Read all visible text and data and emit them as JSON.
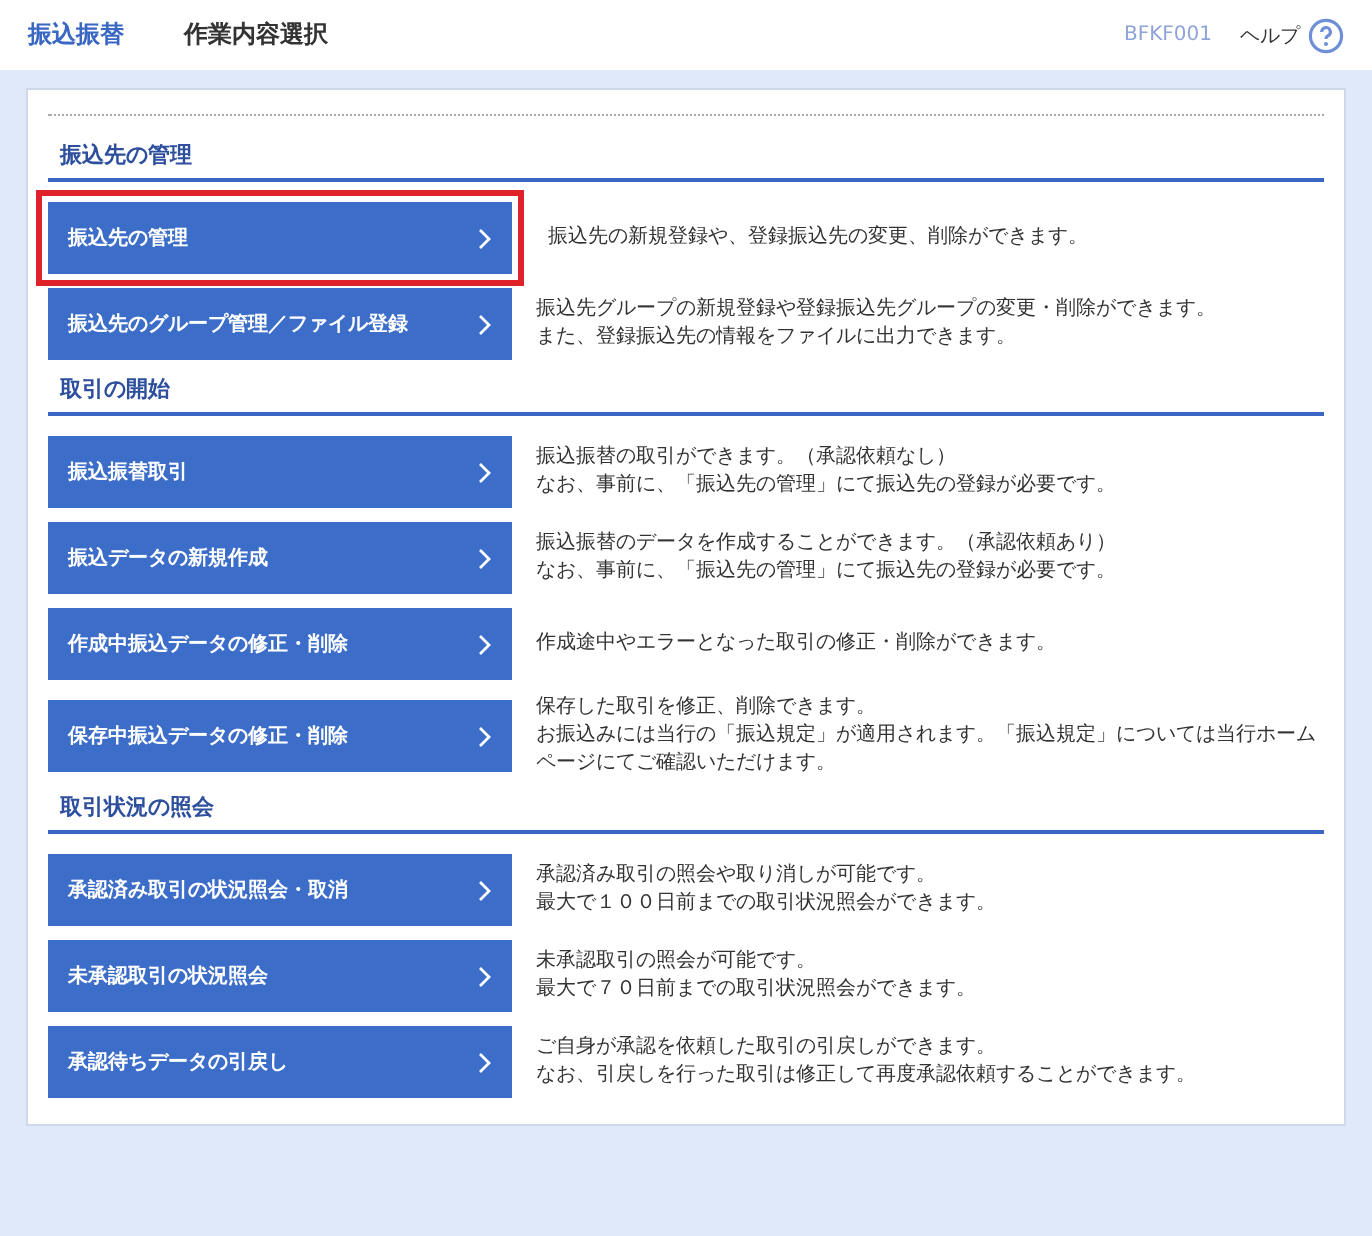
{
  "header": {
    "title": "振込振替",
    "subtitle": "作業内容選択",
    "screen_id": "BFKF001",
    "help": "ヘルプ"
  },
  "sections": [
    {
      "heading": "振込先の管理",
      "items": [
        {
          "label": "振込先の管理",
          "highlighted": true,
          "description": [
            "振込先の新規登録や、登録振込先の変更、削除ができます。"
          ]
        },
        {
          "label": "振込先のグループ管理／ファイル登録",
          "highlighted": false,
          "description": [
            "振込先グループの新規登録や登録振込先グループの変更・削除ができます。",
            "また、登録振込先の情報をファイルに出力できます。"
          ]
        }
      ]
    },
    {
      "heading": "取引の開始",
      "items": [
        {
          "label": "振込振替取引",
          "highlighted": false,
          "description": [
            "振込振替の取引ができます。（承認依頼なし）",
            "なお、事前に、「振込先の管理」にて振込先の登録が必要です。"
          ]
        },
        {
          "label": "振込データの新規作成",
          "highlighted": false,
          "description": [
            "振込振替のデータを作成することができます。（承認依頼あり）",
            "なお、事前に、「振込先の管理」にて振込先の登録が必要です。"
          ]
        },
        {
          "label": "作成中振込データの修正・削除",
          "highlighted": false,
          "description": [
            "作成途中やエラーとなった取引の修正・削除ができます。"
          ]
        },
        {
          "label": "保存中振込データの修正・削除",
          "highlighted": false,
          "description": [
            "保存した取引を修正、削除できます。",
            "お振込みには当行の「振込規定」が適用されます。「振込規定」については当行ホームページにてご確認いただけます。"
          ]
        }
      ]
    },
    {
      "heading": "取引状況の照会",
      "items": [
        {
          "label": "承認済み取引の状況照会・取消",
          "highlighted": false,
          "description": [
            "承認済み取引の照会や取り消しが可能です。",
            "最大で１００日前までの取引状況照会ができます。"
          ]
        },
        {
          "label": "未承認取引の状況照会",
          "highlighted": false,
          "description": [
            "未承認取引の照会が可能です。",
            "最大で７０日前までの取引状況照会ができます。"
          ]
        },
        {
          "label": "承認待ちデータの引戻し",
          "highlighted": false,
          "description": [
            "ご自身が承認を依頼した取引の引戻しができます。",
            "なお、引戻しを行った取引は修正して再度承認依頼することができます。"
          ]
        }
      ]
    }
  ]
}
